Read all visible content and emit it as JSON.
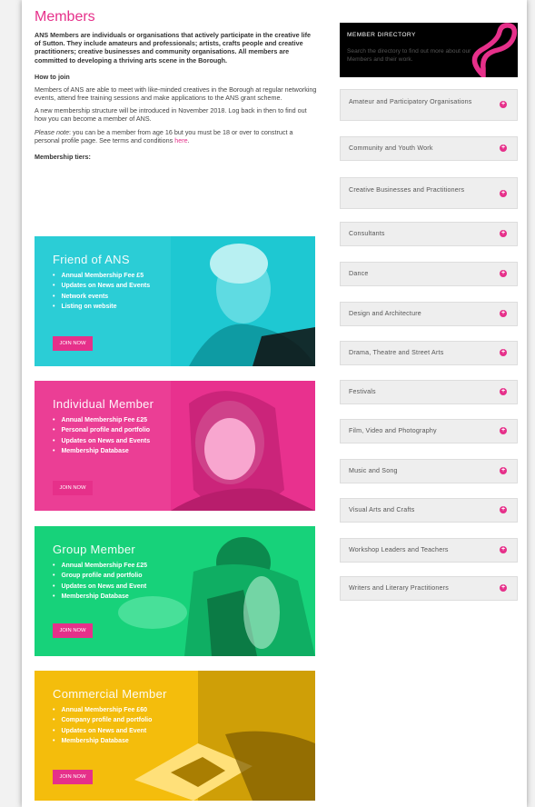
{
  "page": {
    "title": "Members",
    "intro": "ANS Members are individuals or organisations that actively participate in the creative life of Sutton. They include amateurs and professionals; artists, crafts people and creative practitioners; creative businesses and community organisations. All members are committed to developing a thriving arts scene in the Borough.",
    "how_to_join_heading": "How to join",
    "para1": "Members of ANS are able to meet with like-minded creatives in the Borough at regular networking events, attend free training sessions and make applications to the ANS grant scheme.",
    "para2": "A new membership structure will be introduced in November 2018. Log back in then to find out how you can become a member of ANS.",
    "note_label": "Please note",
    "note_text": ": you can be a member from age 16 but you must be 18 or over to construct a personal profile page. See terms and conditions ",
    "note_link": "here",
    "note_end": ".",
    "tiers_heading": "Membership tiers:"
  },
  "tiers": [
    {
      "title": "Friend of ANS",
      "items": [
        "Annual Membership Fee £5",
        "Updates on News and Events",
        "Network events",
        "Listing on website"
      ],
      "button": "JOIN NOW",
      "color": "#1ec8d2"
    },
    {
      "title": "Individual Member",
      "items": [
        "Annual Membership Fee £25",
        "Personal profile and portfolio",
        "Updates on News and Events",
        "Membership Database"
      ],
      "button": "JOIN NOW",
      "color": "#e8318e"
    },
    {
      "title": "Group Member",
      "items": [
        "Annual Membership Fee £25",
        "Group profile and portfolio",
        "Updates on News and Event",
        "Membership Database"
      ],
      "button": "JOIN NOW",
      "color": "#17d27a"
    },
    {
      "title": "Commercial Member",
      "items": [
        "Annual Membership Fee £60",
        "Company profile and portfolio",
        "Updates on News and Event",
        "Membership Database"
      ],
      "button": "JOIN NOW",
      "color": "#f4bd0c"
    }
  ],
  "directory": {
    "title": "MEMBER DIRECTORY",
    "description": "Search the directory to find out more about our Members and their work."
  },
  "categories": [
    "Amateur and Participatory Organisations",
    "Community and Youth Work",
    "Creative Businesses and Practitioners",
    "Consultants",
    "Dance",
    "Design and Architecture",
    "Drama, Theatre and Street Arts",
    "Festivals",
    "Film, Video and Photography",
    "Music and Song",
    "Visual Arts and Crafts",
    "Workshop Leaders and Teachers",
    "Writers and Literary Practitioners"
  ],
  "colors": {
    "accent": "#e6308a"
  },
  "icons": {
    "category": "plus-circle-icon"
  }
}
